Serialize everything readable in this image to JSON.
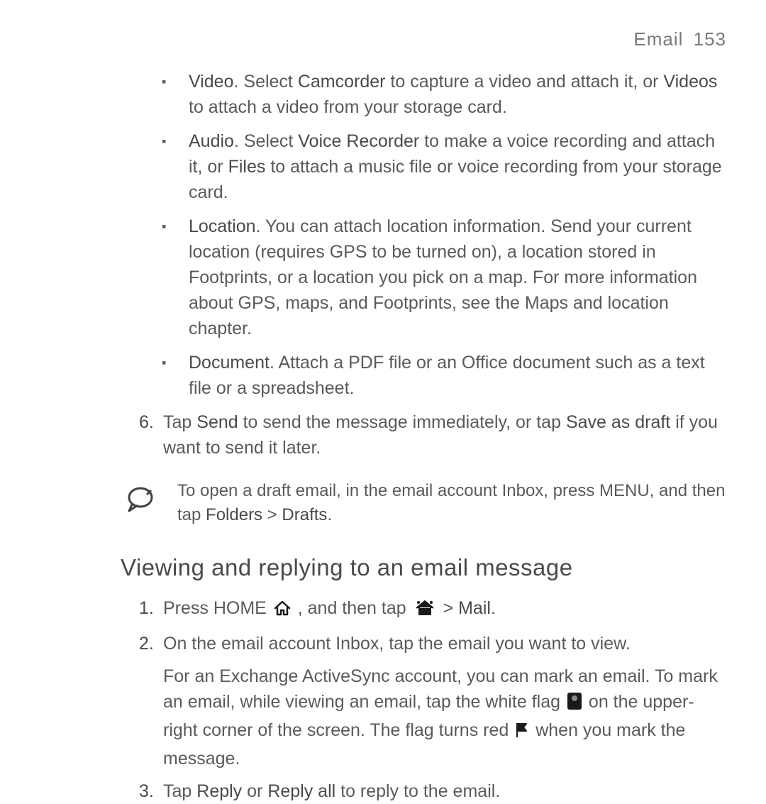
{
  "header": {
    "section": "Email",
    "page": "153"
  },
  "attachments": {
    "video": {
      "label": "Video",
      "sel1": "Camcorder",
      "mid1": ". Select ",
      "after1": " to capture a video and attach it, or ",
      "sel2": "Videos",
      "after2": " to attach a video from your storage card."
    },
    "audio": {
      "label": "Audio",
      "mid1": ". Select ",
      "sel1": "Voice Recorder",
      "after1": " to make a voice recording and attach it, or ",
      "sel2": "Files",
      "after2": " to attach a music file or voice recording from your storage card."
    },
    "location": {
      "label": "Location",
      "rest": ". You can attach location information. Send your current location (requires GPS to be turned on), a location stored in Footprints, or a location you pick on a map. For more information about GPS, maps, and Footprints, see the Maps and location chapter."
    },
    "document": {
      "label": "Document",
      "rest": ". Attach a PDF file or an Office document such as a text file or a spreadsheet."
    }
  },
  "step6": {
    "num": "6.",
    "pre": "Tap ",
    "send": "Send",
    "mid": " to send the message immediately, or tap ",
    "save": "Save as draft",
    "post": " if you want to send it later."
  },
  "note": {
    "pre": "To open a draft email, in the email account Inbox, press MENU, and then tap ",
    "folders": "Folders",
    "gt": " > ",
    "drafts": "Drafts",
    "post": "."
  },
  "section2": {
    "title": "Viewing and replying to an email message"
  },
  "s2steps": {
    "s1": {
      "num": "1.",
      "pre": "Press HOME ",
      "mid": " , and then tap ",
      "gt": " > ",
      "mail": "Mail",
      "post": "."
    },
    "s2": {
      "num": "2.",
      "line1": "On the email account Inbox, tap the email you want to view.",
      "p2a": "For an Exchange ActiveSync account, you can mark an email. To mark an email, while viewing an email, tap the white flag ",
      "p2b": " on the upper-right corner of the screen. The flag turns red ",
      "p2c": " when you mark the message."
    },
    "s3": {
      "num": "3.",
      "pre": "Tap ",
      "reply": "Reply",
      "or": " or ",
      "replyall": "Reply all",
      "post": " to reply to the email."
    }
  }
}
